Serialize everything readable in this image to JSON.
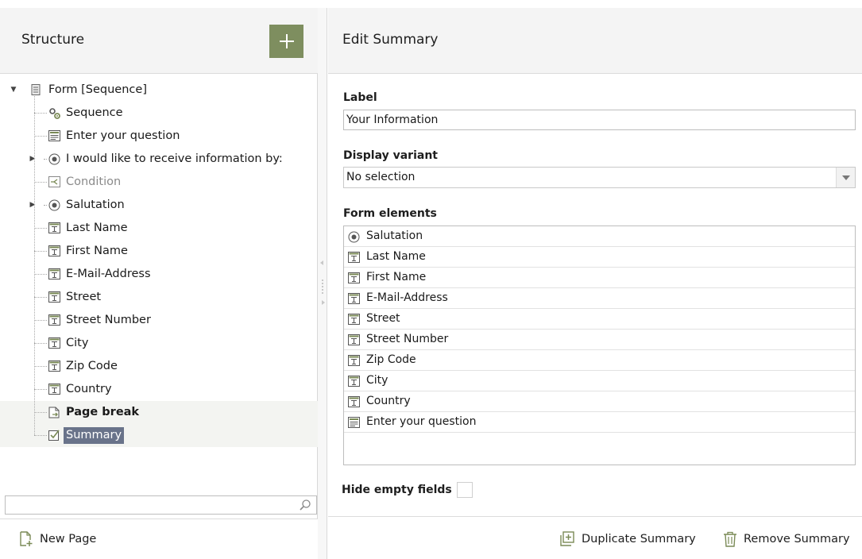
{
  "left_panel": {
    "title": "Structure",
    "add_button_icon": "plus-icon",
    "tree": [
      {
        "label": "Form [Sequence]",
        "icon": "form-icon",
        "level": 0,
        "expander": "expanded"
      },
      {
        "label": "Sequence",
        "icon": "sequence-icon",
        "level": 1
      },
      {
        "label": "Enter your question",
        "icon": "textarea-icon",
        "level": 1
      },
      {
        "label": "I would like to receive information by:",
        "icon": "radio-icon",
        "level": 1,
        "expander": "collapsed"
      },
      {
        "label": "Condition",
        "icon": "condition-icon",
        "level": 1,
        "muted": true
      },
      {
        "label": "Salutation",
        "icon": "radio-icon",
        "level": 1,
        "expander": "collapsed"
      },
      {
        "label": "Last Name",
        "icon": "textfield-icon",
        "level": 1
      },
      {
        "label": "First Name",
        "icon": "textfield-icon",
        "level": 1
      },
      {
        "label": "E-Mail-Address",
        "icon": "textfield-icon",
        "level": 1
      },
      {
        "label": "Street",
        "icon": "textfield-icon",
        "level": 1
      },
      {
        "label": "Street Number",
        "icon": "textfield-icon",
        "level": 1
      },
      {
        "label": "City",
        "icon": "textfield-icon",
        "level": 1
      },
      {
        "label": "Zip Code",
        "icon": "textfield-icon",
        "level": 1
      },
      {
        "label": "Country",
        "icon": "textfield-icon",
        "level": 1
      },
      {
        "label": "Page break",
        "icon": "page-break-icon",
        "level": 1,
        "bold": true
      },
      {
        "label": "Summary",
        "icon": "summary-icon",
        "level": 1,
        "selected": true
      }
    ],
    "search": {
      "value": "",
      "placeholder": ""
    },
    "new_page_label": "New Page"
  },
  "right_panel": {
    "title": "Edit Summary",
    "label_field": {
      "label": "Label",
      "value": "Your Information"
    },
    "display_variant": {
      "label": "Display variant",
      "selected": "No selection"
    },
    "form_elements": {
      "label": "Form elements",
      "items": [
        {
          "label": "Salutation",
          "icon": "radio-icon"
        },
        {
          "label": "Last Name",
          "icon": "textfield-icon"
        },
        {
          "label": "First Name",
          "icon": "textfield-icon"
        },
        {
          "label": "E-Mail-Address",
          "icon": "textfield-icon"
        },
        {
          "label": "Street",
          "icon": "textfield-icon"
        },
        {
          "label": "Street Number",
          "icon": "textfield-icon"
        },
        {
          "label": "Zip Code",
          "icon": "textfield-icon"
        },
        {
          "label": "City",
          "icon": "textfield-icon"
        },
        {
          "label": "Country",
          "icon": "textfield-icon"
        },
        {
          "label": "Enter your question",
          "icon": "textarea-icon"
        }
      ]
    },
    "hide_empty_fields": {
      "label": "Hide empty fields",
      "checked": false
    },
    "duplicate_label": "Duplicate Summary",
    "remove_label": "Remove Summary"
  },
  "colors": {
    "accent_green": "#7e8e5f",
    "selection": "#69738a",
    "icon_green": "#7a8a56"
  }
}
